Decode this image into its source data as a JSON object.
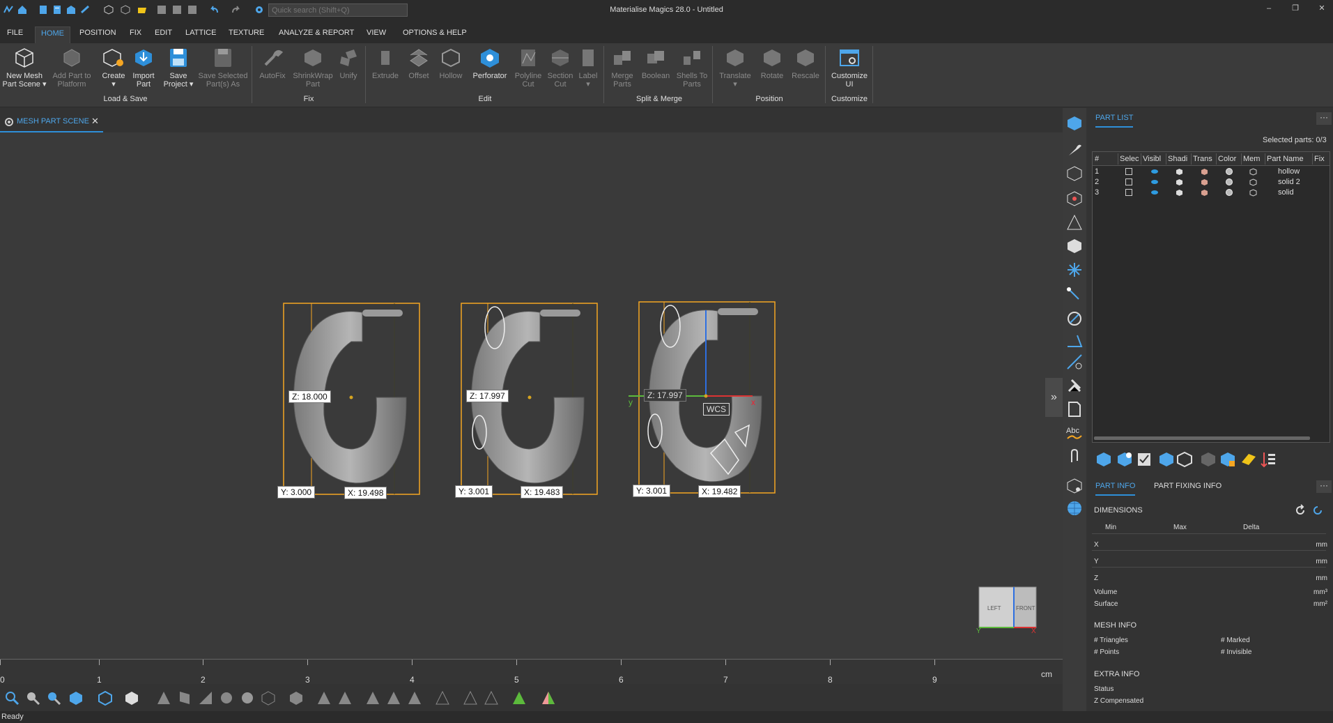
{
  "titlebar": {
    "app_title": "Materialise Magics 28.0 - Untitled",
    "search_placeholder": "Quick search (Shift+Q)",
    "window_buttons": [
      "–",
      "❐",
      "✕"
    ]
  },
  "menu": {
    "tabs": [
      "FILE",
      "HOME",
      "POSITION",
      "FIX",
      "EDIT",
      "LATTICE",
      "TEXTURE",
      "ANALYZE & REPORT",
      "VIEW",
      "OPTIONS & HELP"
    ],
    "active": "HOME"
  },
  "ribbon": {
    "buttons": [
      {
        "label1": "New Mesh",
        "label2": "Part Scene ▾",
        "icon": "new-mesh-scene-icon",
        "enabled": true
      },
      {
        "label1": "Add Part to",
        "label2": "Platform",
        "icon": "add-part-icon",
        "enabled": false
      },
      {
        "label1": "Create",
        "label2": "▾",
        "icon": "create-icon",
        "enabled": true
      },
      {
        "label1": "Import",
        "label2": "Part",
        "icon": "import-part-icon",
        "enabled": true
      },
      {
        "label1": "Save",
        "label2": "Project ▾",
        "icon": "save-project-icon",
        "enabled": true
      },
      {
        "label1": "Save Selected",
        "label2": "Part(s) As",
        "icon": "save-selected-icon",
        "enabled": false
      },
      {
        "label1": "AutoFix",
        "label2": "",
        "icon": "autofix-icon",
        "enabled": false
      },
      {
        "label1": "ShrinkWrap",
        "label2": "Part",
        "icon": "shrinkwrap-icon",
        "enabled": false
      },
      {
        "label1": "Unify",
        "label2": "",
        "icon": "unify-icon",
        "enabled": false
      },
      {
        "label1": "Extrude",
        "label2": "",
        "icon": "extrude-icon",
        "enabled": false
      },
      {
        "label1": "Offset",
        "label2": "",
        "icon": "offset-icon",
        "enabled": false
      },
      {
        "label1": "Hollow",
        "label2": "",
        "icon": "hollow-icon",
        "enabled": false
      },
      {
        "label1": "Perforator",
        "label2": "",
        "icon": "perforator-icon",
        "enabled": true
      },
      {
        "label1": "Polyline",
        "label2": "Cut",
        "icon": "polyline-cut-icon",
        "enabled": false
      },
      {
        "label1": "Section",
        "label2": "Cut",
        "icon": "section-cut-icon",
        "enabled": false
      },
      {
        "label1": "Label",
        "label2": "▾",
        "icon": "label-icon",
        "enabled": false
      },
      {
        "label1": "Merge",
        "label2": "Parts",
        "icon": "merge-parts-icon",
        "enabled": false
      },
      {
        "label1": "Boolean",
        "label2": "",
        "icon": "boolean-icon",
        "enabled": false
      },
      {
        "label1": "Shells To",
        "label2": "Parts",
        "icon": "shells-to-parts-icon",
        "enabled": false
      },
      {
        "label1": "Translate",
        "label2": "▾",
        "icon": "translate-icon",
        "enabled": false
      },
      {
        "label1": "Rotate",
        "label2": "",
        "icon": "rotate-icon",
        "enabled": false
      },
      {
        "label1": "Rescale",
        "label2": "",
        "icon": "rescale-icon",
        "enabled": false
      },
      {
        "label1": "Customize",
        "label2": "UI",
        "icon": "customize-ui-icon",
        "enabled": true
      }
    ],
    "groups": [
      "Load & Save",
      "Fix",
      "Edit",
      "Split & Merge",
      "Position",
      "Customize"
    ]
  },
  "document_tab": {
    "label": "MESH PART SCENE",
    "close": "✕"
  },
  "scene": {
    "parts": [
      {
        "name": "hollow",
        "z": "Z: 18.000",
        "y": "Y: 3.000",
        "x": "X: 19.498"
      },
      {
        "name": "solid 2",
        "z": "Z: 17.997",
        "y": "Y: 3.001",
        "x": "X: 19.483"
      },
      {
        "name": "solid",
        "z": "Z: 17.997",
        "y": "Y: 3.001",
        "x": "X: 19.482"
      }
    ],
    "wcs": "WCS",
    "axis_x": "x",
    "axis_y": "y",
    "collapse": "»",
    "view_cube": {
      "left": "LEFT",
      "front": "FRONT",
      "y": "Y",
      "x": "X"
    }
  },
  "ruler": {
    "ticks": [
      "0",
      "1",
      "2",
      "3",
      "4",
      "5",
      "6",
      "7",
      "8",
      "9"
    ],
    "unit": "cm"
  },
  "status": "Ready",
  "part_list": {
    "tab": "PART LIST",
    "more": "···",
    "selected_parts": "Selected parts: 0/3",
    "columns": [
      "#",
      "Selec",
      "Visibl",
      "Shadi",
      "Trans",
      "Color",
      "Mem",
      "Part Name",
      "Fix"
    ],
    "rows": [
      {
        "num": "1",
        "name": "hollow"
      },
      {
        "num": "2",
        "name": "solid 2"
      },
      {
        "num": "3",
        "name": "solid"
      }
    ],
    "visible_color": "#2e9be0"
  },
  "part_info": {
    "tabs": [
      "PART INFO",
      "PART FIXING INFO"
    ],
    "more": "···",
    "dimensions": "DIMENSIONS",
    "dim_cols": [
      "Min",
      "Max",
      "Delta"
    ],
    "dim_rows": [
      {
        "label": "X",
        "unit": "mm"
      },
      {
        "label": "Y",
        "unit": "mm"
      },
      {
        "label": "Z",
        "unit": "mm"
      }
    ],
    "volume": "Volume",
    "volume_unit": "mm³",
    "surface": "Surface",
    "surface_unit": "mm²",
    "mesh_info": "MESH INFO",
    "triangles": "# Triangles",
    "points": "# Points",
    "marked": "# Marked",
    "invisible": "# Invisible",
    "extra_info": "EXTRA INFO",
    "status": "Status",
    "z_compensated": "Z Compensated"
  },
  "colors": {
    "accent": "#2e8fd9",
    "bbox": "#f5a623",
    "background": "#3a3a3a"
  }
}
